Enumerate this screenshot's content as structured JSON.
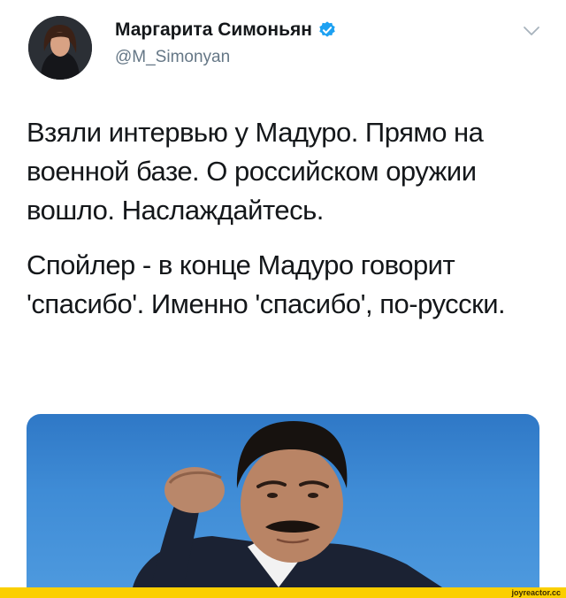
{
  "author": {
    "name": "Маргарита Симоньян",
    "handle": "@M_Simonyan",
    "verified": true
  },
  "tweet": {
    "paragraphs": [
      "Взяли интервью у Мадуро. Прямо на военной базе. О российском оружии вошло. Наслаждайтесь.",
      "Спойлер - в конце Мадуро говорит 'спасибо'. Именно 'спасибо', по-русски."
    ]
  },
  "icons": {
    "verified": "verified-badge-icon",
    "menu": "chevron-down-icon"
  },
  "watermark": {
    "text": "joyreactor.cc"
  },
  "colors": {
    "text": "#14171a",
    "secondary_text": "#657786",
    "verified_blue": "#1da1f2",
    "media_background": "#3f8cd6",
    "footer_bar": "#fbcf00"
  }
}
